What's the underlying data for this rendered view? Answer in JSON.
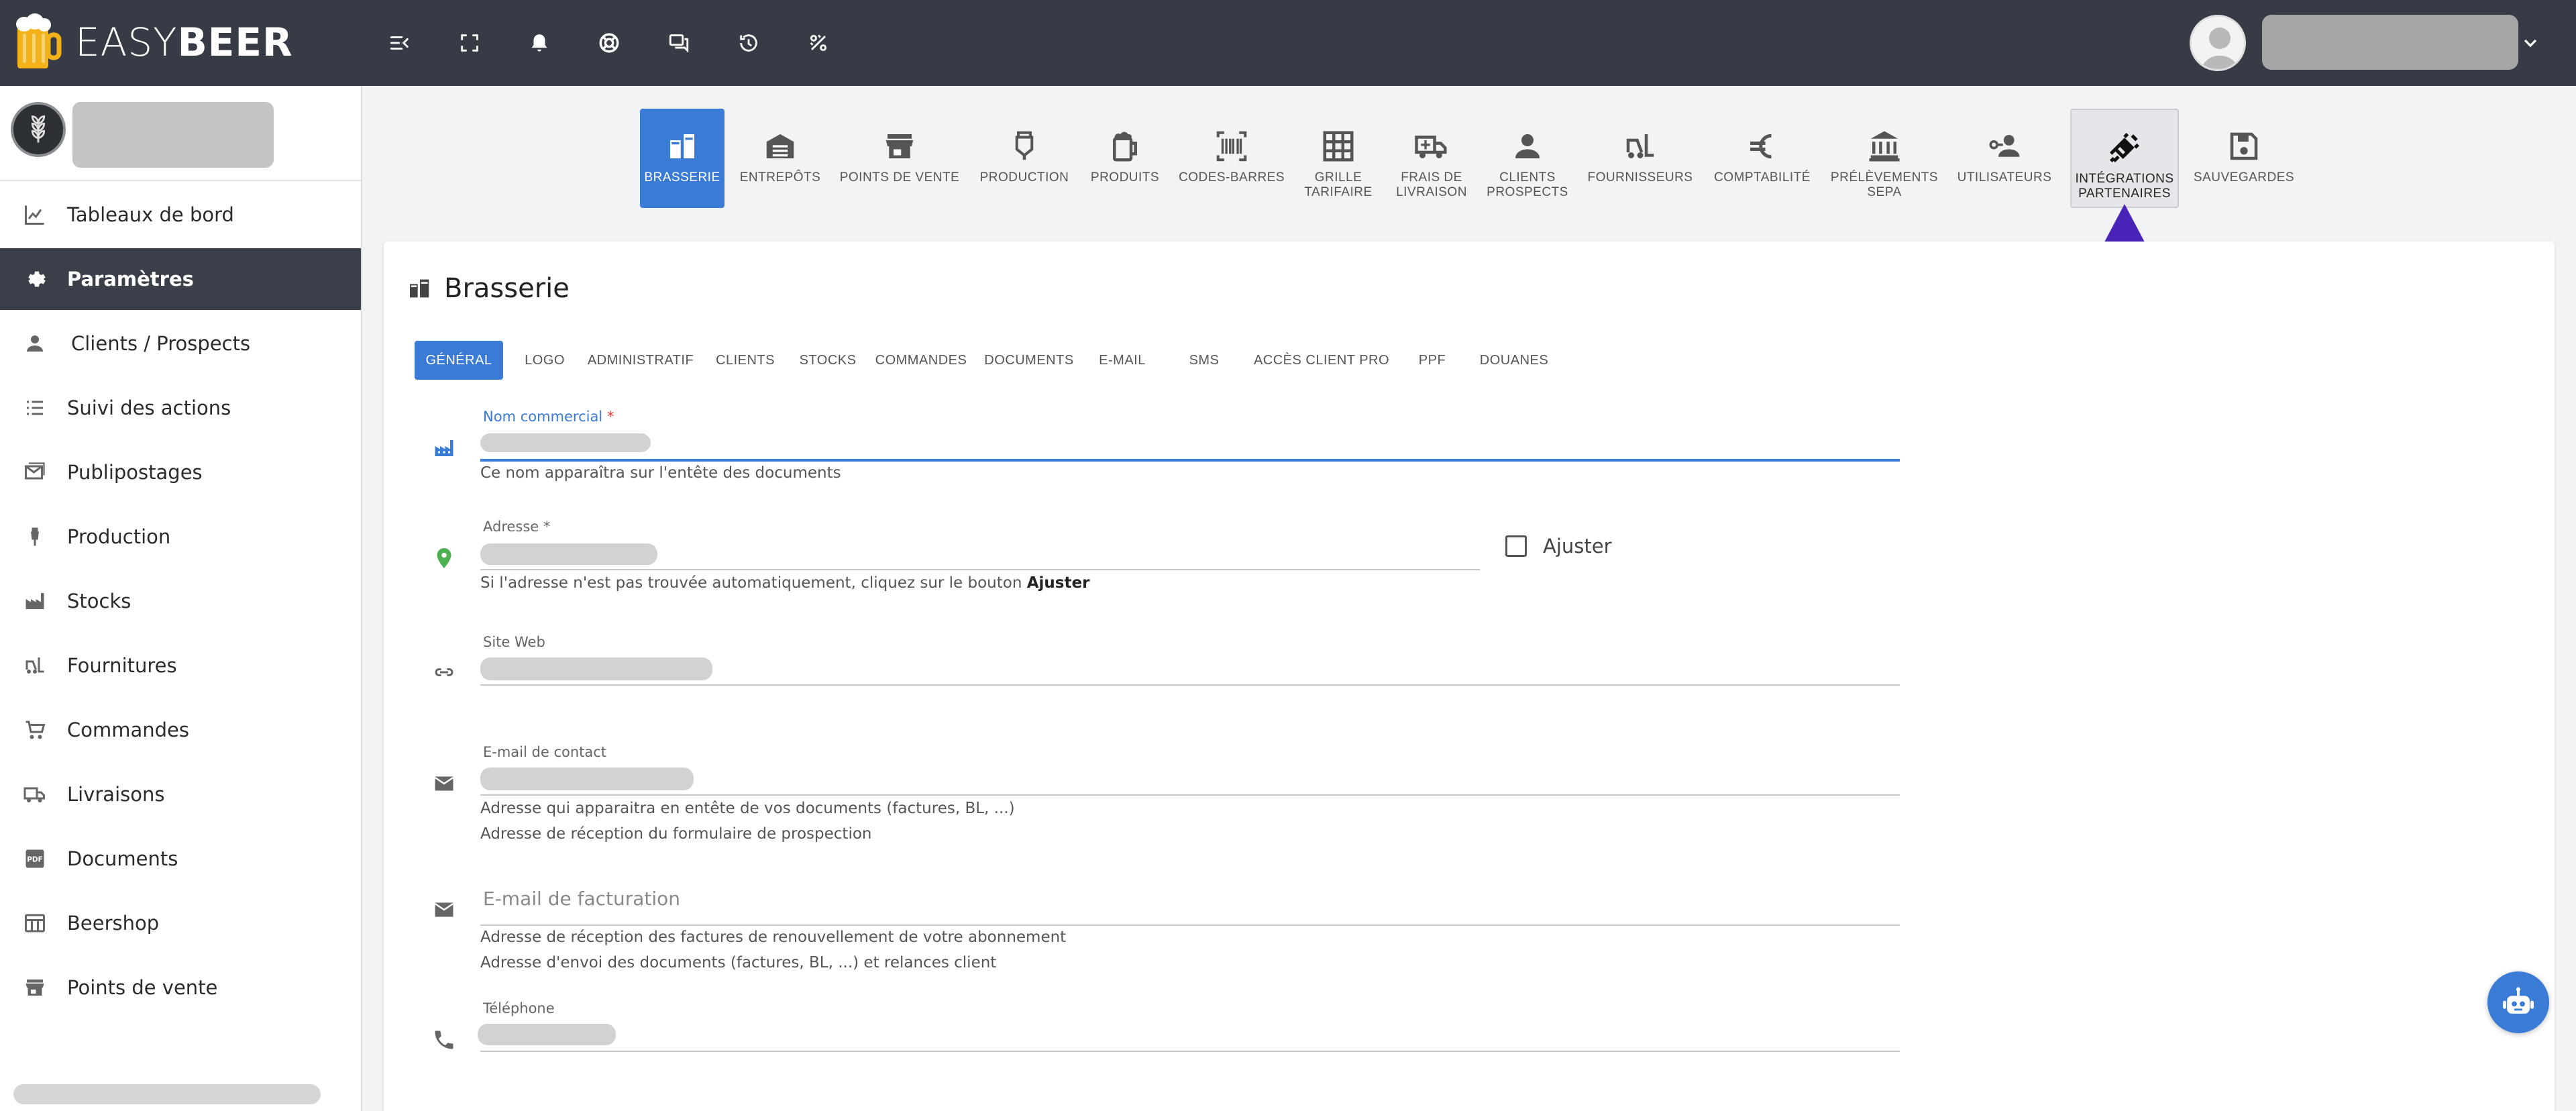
{
  "brand": {
    "name_light": "EASY",
    "name_bold": "BEER"
  },
  "topbar": {
    "icons": [
      "menu-collapse-icon",
      "fullscreen-icon",
      "bell-icon",
      "support-icon",
      "chat-icon",
      "history-icon",
      "percent-icon"
    ]
  },
  "sidebar": {
    "items": [
      {
        "label": "Tableaux de bord",
        "icon": "chart-icon"
      },
      {
        "label": "Paramètres",
        "icon": "gear-icon",
        "active": true
      },
      {
        "label": "Clients / Prospects",
        "icon": "person-icon"
      },
      {
        "label": "Suivi des actions",
        "icon": "list-icon"
      },
      {
        "label": "Publipostages",
        "icon": "mail-icon"
      },
      {
        "label": "Production",
        "icon": "tap-icon"
      },
      {
        "label": "Stocks",
        "icon": "factory-icon"
      },
      {
        "label": "Fournitures",
        "icon": "forklift-icon"
      },
      {
        "label": "Commandes",
        "icon": "cart-icon"
      },
      {
        "label": "Livraisons",
        "icon": "truck-icon"
      },
      {
        "label": "Documents",
        "icon": "pdf-icon"
      },
      {
        "label": "Beershop",
        "icon": "shop-icon"
      },
      {
        "label": "Points de vente",
        "icon": "store-icon"
      }
    ]
  },
  "settings_tabs": [
    {
      "label": "Brasserie",
      "icon": "brewery-icon"
    },
    {
      "label": "Entrepôts",
      "icon": "warehouse-icon"
    },
    {
      "label": "Points de vente",
      "icon": "store-icon"
    },
    {
      "label": "Production",
      "icon": "tank-icon"
    },
    {
      "label": "Produits",
      "icon": "beer-mug-icon"
    },
    {
      "label": "Codes-barres",
      "icon": "barcode-icon"
    },
    {
      "label": "Grille\ntarifaire",
      "icon": "grid-icon"
    },
    {
      "label": "Frais de\nlivraison",
      "icon": "delivery-icon"
    },
    {
      "label": "Clients\nprospects",
      "icon": "person-icon"
    },
    {
      "label": "Fournisseurs",
      "icon": "forklift-icon"
    },
    {
      "label": "Comptabilité",
      "icon": "euro-icon"
    },
    {
      "label": "Prélèvements\nSEPA",
      "icon": "bank-icon"
    },
    {
      "label": "Utilisateurs",
      "icon": "user-key-icon"
    },
    {
      "label": "Intégrations\npartenaires",
      "icon": "plug-icon"
    },
    {
      "label": "Sauvegardes",
      "icon": "save-icon"
    }
  ],
  "card": {
    "title": "Brasserie",
    "sub_tabs": [
      "GÉNÉRAL",
      "LOGO",
      "ADMINISTRATIF",
      "CLIENTS",
      "STOCKS",
      "COMMANDES",
      "DOCUMENTS",
      "E-MAIL",
      "SMS",
      "ACCÈS CLIENT PRO",
      "PPF",
      "DOUANES"
    ]
  },
  "form": {
    "nom_commercial": {
      "label": "Nom commercial",
      "required": "*",
      "helper": "Ce nom apparaîtra sur l'entête des documents"
    },
    "adresse": {
      "label": "Adresse",
      "required": "*",
      "helper": "Si l'adresse n'est pas trouvée automatiquement, cliquez sur le bouton",
      "helper_bold": "Ajuster",
      "checkbox_label": "Ajuster"
    },
    "site_web": {
      "label": "Site Web"
    },
    "email_contact": {
      "label": "E-mail de contact",
      "helper1": "Adresse qui apparaitra en entête de vos documents (factures, BL, ...)",
      "helper2": "Adresse de réception du formulaire de prospection"
    },
    "email_facturation": {
      "placeholder": "E-mail de facturation",
      "helper1": "Adresse de réception des factures de renouvellement de votre abonnement",
      "helper2": "Adresse d'envoi des documents (factures, BL, ...) et relances client"
    },
    "telephone": {
      "label": "Téléphone"
    }
  },
  "colors": {
    "topbar": "#363b46",
    "accent": "#3a7bd5",
    "arrow": "#4a23b8",
    "sidebar_active": "#3a3f4a"
  }
}
